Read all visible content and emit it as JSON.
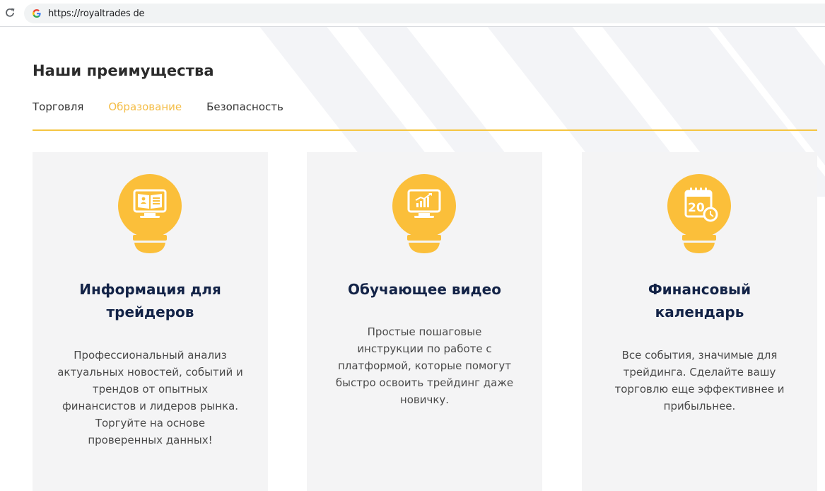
{
  "browser": {
    "url": "https://royaltrades de",
    "reload_icon": "reload-icon",
    "favicon": "google-g-icon"
  },
  "section": {
    "title": "Наши преимущества",
    "tabs": [
      {
        "label": "Торговля",
        "active": false
      },
      {
        "label": "Образование",
        "active": true
      },
      {
        "label": "Безопасность",
        "active": false
      }
    ]
  },
  "colors": {
    "accent": "#f5c542",
    "active_tab": "#f4bd46",
    "title_navy": "#132347",
    "card_bg": "#f4f4f5",
    "icon_yellow": "#fbbf3a"
  },
  "cards": [
    {
      "icon": "book-monitor-icon",
      "title_line1": "Информация для",
      "title_line2": "трейдеров",
      "desc_lines": [
        "Профессиональный анализ",
        "актуальных новостей, событий и",
        "трендов от опытных",
        "финансистов и лидеров рынка.",
        "Торгуйте на основе",
        "проверенных данных!"
      ]
    },
    {
      "icon": "chart-monitor-icon",
      "title_line1": "Обучающее видео",
      "title_line2": "",
      "desc_lines": [
        "Простые пошаговые",
        "инструкции по работе с",
        "платформой, которые помогут",
        "быстро освоить трейдинг даже",
        "новичку."
      ]
    },
    {
      "icon": "calendar-clock-icon",
      "title_line1": "Финансовый",
      "title_line2": "календарь",
      "desc_lines": [
        "Все события, значимые для",
        "трейдинга. Сделайте вашу",
        "торговлю еще эффективнее и",
        "прибыльнее."
      ]
    }
  ]
}
